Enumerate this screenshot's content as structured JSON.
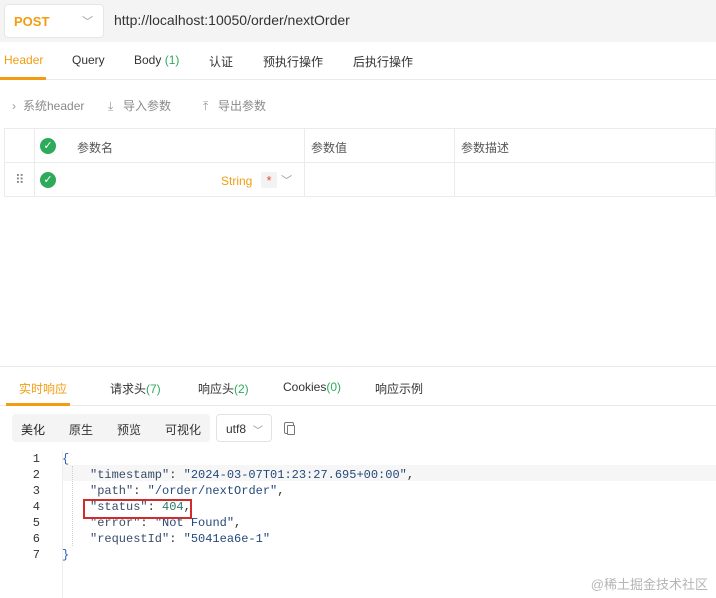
{
  "request": {
    "method": "POST",
    "url": "http://localhost:10050/order/nextOrder"
  },
  "req_tabs": {
    "header": "Header",
    "query": "Query",
    "body": "Body",
    "body_count": "(1)",
    "auth": "认证",
    "pre": "预执行操作",
    "post": "后执行操作"
  },
  "param_tools": {
    "system_header": "系统header",
    "import": "导入参数",
    "export": "导出参数"
  },
  "param_table": {
    "col_name": "参数名",
    "col_value": "参数值",
    "col_desc": "参数描述",
    "row_type": "String",
    "row_required": "*"
  },
  "resp_tabs": {
    "realtime": "实时响应",
    "req_headers": "请求头",
    "req_headers_count": "(7)",
    "resp_headers": "响应头",
    "resp_headers_count": "(2)",
    "cookies": "Cookies",
    "cookies_count": "(0)",
    "example": "响应示例"
  },
  "view": {
    "pretty": "美化",
    "raw": "原生",
    "preview": "预览",
    "visualize": "可视化",
    "encoding": "utf8"
  },
  "code": {
    "line_numbers": [
      "1",
      "2",
      "3",
      "4",
      "5",
      "6",
      "7"
    ],
    "open": "{",
    "close": "}",
    "fields": [
      {
        "key": "\"timestamp\"",
        "value": "\"2024-03-07T01:23:27.695+00:00\"",
        "tail": ","
      },
      {
        "key": "\"path\"",
        "value": "\"/order/nextOrder\"",
        "tail": ","
      },
      {
        "key": "\"status\"",
        "value": "404",
        "tail": ","
      },
      {
        "key": "\"error\"",
        "value": "\"Not Found\"",
        "tail": ","
      },
      {
        "key": "\"requestId\"",
        "value": "\"5041ea6e-1\"",
        "tail": ""
      }
    ]
  },
  "watermark": "@稀土掘金技术社区",
  "colors": {
    "accent": "#f39c12",
    "check": "#2eaa5b",
    "highlight_box": "#d12b2b"
  }
}
